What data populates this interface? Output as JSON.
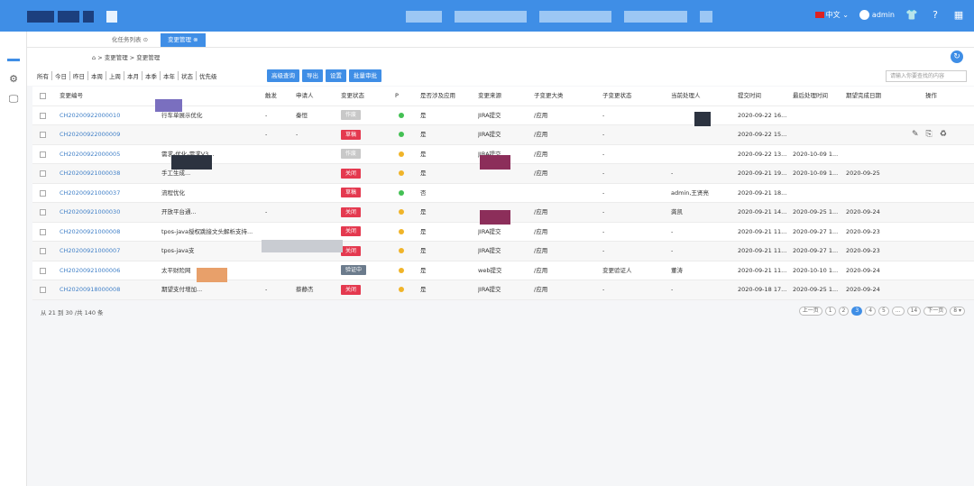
{
  "topbar": {
    "lang": "中文",
    "user": "admin",
    "icons": [
      "shirt-icon",
      "help-icon",
      "grid-icon"
    ]
  },
  "tabs": [
    {
      "label": "化任务列表 ⊙"
    },
    {
      "label": "变更管理 ⊗"
    }
  ],
  "breadcrumb": "⌂ > 变更管理 > 变更管理",
  "filters": [
    "所有",
    "今日",
    "昨日",
    "本周",
    "上周",
    "本月",
    "本季",
    "本年",
    "状态",
    "优先级"
  ],
  "buttons": [
    "高级查询",
    "导出",
    "设置",
    "批量审批"
  ],
  "search_placeholder": "请输入你要查找的内容",
  "columns": [
    "变更编号",
    "",
    "触发",
    "申请人",
    "变更状态",
    "P",
    "是否涉及应用",
    "变更来源",
    "子变更大类",
    "子变更状态",
    "当前处理人",
    "提交时间",
    "最后处理时间",
    "期望完成日期",
    "操作"
  ],
  "rows": [
    {
      "id": "CH20200922000010",
      "title": "行车单展示优化",
      "trigger": "-",
      "applicant": "秦恒",
      "status": "作废",
      "status_color": "#c8c8c8",
      "dot": "#44c054",
      "app": "是",
      "source": "JIRA提交",
      "cat": "/应用",
      "substate": "-",
      "handler": "",
      "submit": "2020-09-22 16...",
      "last": "",
      "expect": ""
    },
    {
      "id": "CH20200922000009",
      "title": "",
      "trigger": "-",
      "applicant": "-",
      "status": "草稿",
      "status_color": "#e4394f",
      "dot": "#44c054",
      "app": "是",
      "source": "JIRA提交",
      "cat": "/应用",
      "substate": "-",
      "handler": "",
      "submit": "2020-09-22 15...",
      "last": "",
      "expect": ""
    },
    {
      "id": "CH20200922000005",
      "title": "需求-优化-需求V3...",
      "trigger": "",
      "applicant": "",
      "status": "作废",
      "status_color": "#c8c8c8",
      "dot": "#f0b429",
      "app": "是",
      "source": "JIRA提交",
      "cat": "/应用",
      "substate": "-",
      "handler": "",
      "submit": "2020-09-22 13...",
      "last": "2020-10-09 1...",
      "expect": ""
    },
    {
      "id": "CH20200921000038",
      "title": "手工生成...",
      "trigger": "",
      "applicant": "",
      "status": "关闭",
      "status_color": "#e4394f",
      "dot": "#f0b429",
      "app": "是",
      "source": "",
      "cat": "/应用",
      "substate": "-",
      "handler": "-",
      "submit": "2020-09-21 19...",
      "last": "2020-10-09 1...",
      "expect": "2020-09-25"
    },
    {
      "id": "CH20200921000037",
      "title": "流程优化",
      "trigger": "",
      "applicant": "",
      "status": "草稿",
      "status_color": "#e4394f",
      "dot": "#44c054",
      "app": "否",
      "source": "",
      "cat": "",
      "substate": "-",
      "handler": "admin,王贤亮",
      "submit": "2020-09-21 18...",
      "last": "",
      "expect": ""
    },
    {
      "id": "CH20200921000030",
      "title": "开放平台通...",
      "trigger": "-",
      "applicant": "",
      "status": "关闭",
      "status_color": "#e4394f",
      "dot": "#f0b429",
      "app": "是",
      "source": "",
      "cat": "/应用",
      "substate": "-",
      "handler": "龚凯",
      "submit": "2020-09-21 14...",
      "last": "2020-09-25 1...",
      "expect": "2020-09-24"
    },
    {
      "id": "CH20200921000008",
      "title": "tpos-java授权跳接文头解析支持...",
      "trigger": "",
      "applicant": "",
      "status": "关闭",
      "status_color": "#e4394f",
      "dot": "#f0b429",
      "app": "是",
      "source": "JIRA提交",
      "cat": "/应用",
      "substate": "-",
      "handler": "-",
      "submit": "2020-09-21 11...",
      "last": "2020-09-27 1...",
      "expect": "2020-09-23"
    },
    {
      "id": "CH20200921000007",
      "title": "tpos-java支",
      "trigger": "",
      "applicant": "",
      "status": "关闭",
      "status_color": "#e4394f",
      "dot": "#f0b429",
      "app": "是",
      "source": "JIRA提交",
      "cat": "/应用",
      "substate": "-",
      "handler": "-",
      "submit": "2020-09-21 11...",
      "last": "2020-09-27 1...",
      "expect": "2020-09-23"
    },
    {
      "id": "CH20200921000006",
      "title": "太平财险网",
      "trigger": "",
      "applicant": "",
      "status": "验证中",
      "status_color": "#6b7b8c",
      "dot": "#f0b429",
      "app": "是",
      "source": "web提交",
      "cat": "/应用",
      "substate": "变更验证人",
      "handler": "董涛",
      "submit": "2020-09-21 11...",
      "last": "2020-10-10 1...",
      "expect": "2020-09-24"
    },
    {
      "id": "CH20200918000008",
      "title": "期望支付增加...",
      "trigger": "-",
      "applicant": "蔡静杰",
      "status": "关闭",
      "status_color": "#e4394f",
      "dot": "#f0b429",
      "app": "是",
      "source": "JIRA提交",
      "cat": "/应用",
      "substate": "-",
      "handler": "-",
      "submit": "2020-09-18 17...",
      "last": "2020-09-25 1...",
      "expect": "2020-09-24"
    }
  ],
  "footer_text": "从 21 到 30 /共 140 条",
  "pager": [
    "上一页",
    "1",
    "2",
    "3",
    "4",
    "5",
    "...",
    "14",
    "下一页"
  ],
  "pager_active": "3",
  "page_size": "8 ▾"
}
